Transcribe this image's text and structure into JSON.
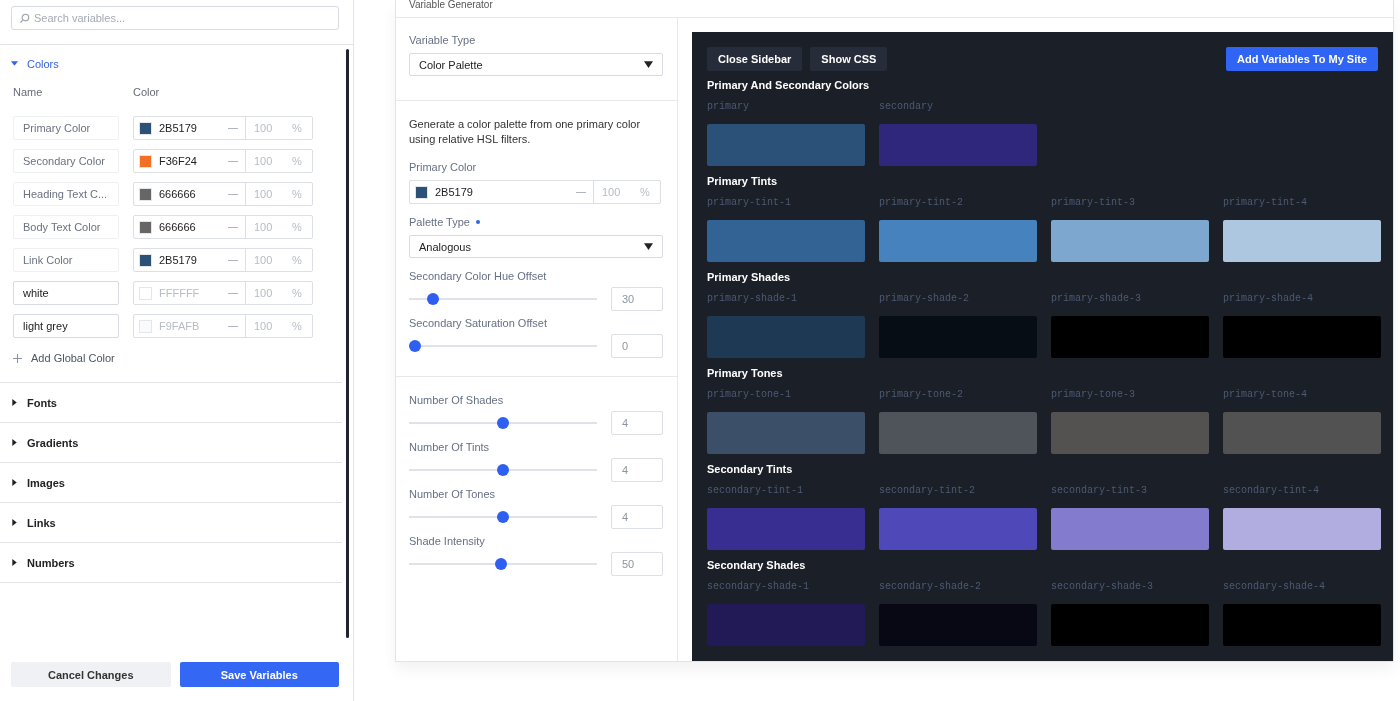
{
  "sidebar": {
    "search": {
      "placeholder": "Search variables..."
    },
    "sections": [
      {
        "label": "Colors",
        "expanded": true
      },
      {
        "label": "Fonts",
        "expanded": false
      },
      {
        "label": "Gradients",
        "expanded": false
      },
      {
        "label": "Images",
        "expanded": false
      },
      {
        "label": "Links",
        "expanded": false
      },
      {
        "label": "Numbers",
        "expanded": false
      }
    ],
    "colors": {
      "columns": [
        "Name",
        "Color"
      ],
      "rows": [
        {
          "name": "Primary Color",
          "editable": false,
          "color": "#2b5179",
          "hex": "2B5179",
          "opacity": "100",
          "unit": "%"
        },
        {
          "name": "Secondary Color",
          "editable": false,
          "color": "#f36f24",
          "hex": "F36F24",
          "opacity": "100",
          "unit": "%"
        },
        {
          "name": "Heading Text C...",
          "editable": false,
          "color": "#666666",
          "hex": "666666",
          "opacity": "100",
          "unit": "%"
        },
        {
          "name": "Body Text Color",
          "editable": false,
          "color": "#666666",
          "hex": "666666",
          "opacity": "100",
          "unit": "%"
        },
        {
          "name": "Link Color",
          "editable": false,
          "color": "#2b5179",
          "hex": "2B5179",
          "opacity": "100",
          "unit": "%"
        },
        {
          "name": "white",
          "editable": true,
          "color": "#ffffff",
          "hex": "FFFFFF",
          "opacity": "100",
          "unit": "%"
        },
        {
          "name": "light grey",
          "editable": true,
          "color": "#f9fafb",
          "hex": "F9FAFB",
          "opacity": "100",
          "unit": "%"
        }
      ],
      "add_label": "Add Global Color"
    },
    "buttons": {
      "cancel": "Cancel Changes",
      "save": "Save Variables"
    }
  },
  "generator": {
    "title": "Variable Generator",
    "variable_type": {
      "label": "Variable Type",
      "value": "Color Palette"
    },
    "description": "Generate a color palette from one primary color using relative HSL filters.",
    "primary_color": {
      "label": "Primary Color",
      "color": "#2b5179",
      "hex": "2B5179",
      "opacity": "100",
      "unit": "%"
    },
    "palette_type": {
      "label": "Palette Type",
      "required": true,
      "value": "Analogous"
    },
    "offsets": [
      {
        "label": "Secondary Color Hue Offset",
        "level": 0.1,
        "value": "30"
      },
      {
        "label": "Secondary Saturation Offset",
        "level": 0,
        "value": "0"
      }
    ],
    "counts": [
      {
        "label": "Number Of Shades",
        "level": 0.5,
        "value": "4"
      },
      {
        "label": "Number Of Tints",
        "level": 0.5,
        "value": "4"
      },
      {
        "label": "Number Of Tones",
        "level": 0.5,
        "value": "4"
      },
      {
        "label": "Shade Intensity",
        "level": 0.49,
        "value": "50"
      }
    ],
    "preview": {
      "buttons": [
        "Close Sidebar",
        "Show CSS"
      ],
      "add_button": "Add Variables To My Site",
      "groups": [
        {
          "title": "Primary And Secondary Colors",
          "swatches": [
            {
              "name": "primary",
              "color": "#2b5179"
            },
            {
              "name": "secondary",
              "color": "#2e277b"
            }
          ]
        },
        {
          "title": "Primary Tints",
          "swatches": [
            {
              "name": "primary-tint-1",
              "color": "#336394"
            },
            {
              "name": "primary-tint-2",
              "color": "#4682bd"
            },
            {
              "name": "primary-tint-3",
              "color": "#7ea7cf"
            },
            {
              "name": "primary-tint-4",
              "color": "#adc7e1"
            }
          ]
        },
        {
          "title": "Primary Shades",
          "swatches": [
            {
              "name": "primary-shade-1",
              "color": "#1d3954"
            },
            {
              "name": "primary-shade-2",
              "color": "#070d14"
            },
            {
              "name": "primary-shade-3",
              "color": "#000000"
            },
            {
              "name": "primary-shade-4",
              "color": "#000000"
            }
          ]
        },
        {
          "title": "Primary Tones",
          "swatches": [
            {
              "name": "primary-tone-1",
              "color": "#3b5068"
            },
            {
              "name": "primary-tone-2",
              "color": "#4f535a"
            },
            {
              "name": "primary-tone-3",
              "color": "#545250"
            },
            {
              "name": "primary-tone-4",
              "color": "#525252"
            }
          ]
        },
        {
          "title": "Secondary Tints",
          "swatches": [
            {
              "name": "secondary-tint-1",
              "color": "#382e91"
            },
            {
              "name": "secondary-tint-2",
              "color": "#4f48b9"
            },
            {
              "name": "secondary-tint-3",
              "color": "#837bce"
            },
            {
              "name": "secondary-tint-4",
              "color": "#b2ade0"
            }
          ]
        },
        {
          "title": "Secondary Shades",
          "swatches": [
            {
              "name": "secondary-shade-1",
              "color": "#211a56"
            },
            {
              "name": "secondary-shade-2",
              "color": "#080714"
            },
            {
              "name": "secondary-shade-3",
              "color": "#000000"
            },
            {
              "name": "secondary-shade-4",
              "color": "#000000"
            }
          ]
        }
      ]
    }
  }
}
